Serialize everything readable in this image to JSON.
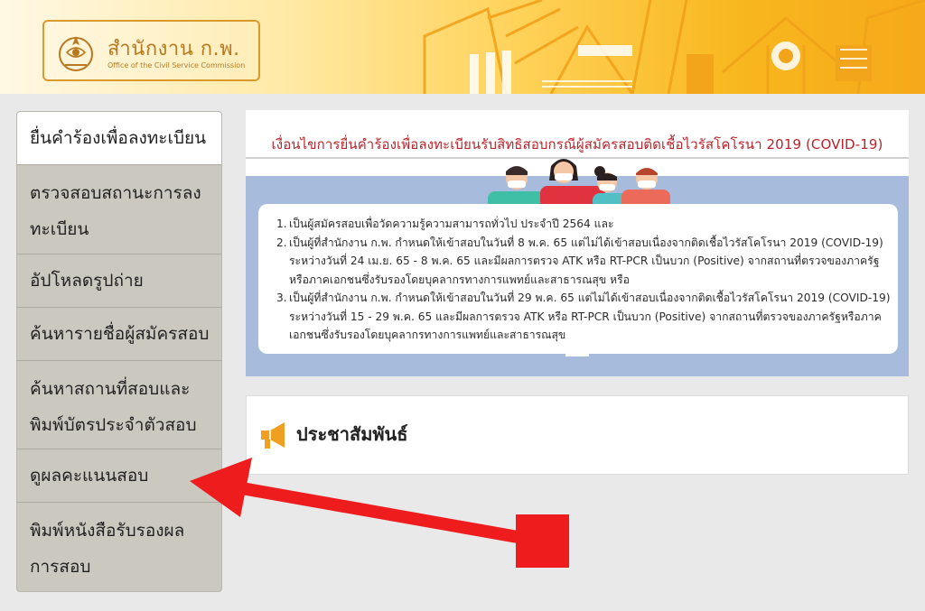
{
  "header": {
    "logo_title": "สำนักงาน ก.พ.",
    "logo_subtitle": "Office of the Civil Service Commission",
    "emblem_icon": "garuda-emblem-icon"
  },
  "sidebar": {
    "items": [
      {
        "label": "ยื่นคำร้องเพื่อลงทะเบียน",
        "active": true
      },
      {
        "label_line1": "ตรวจสอบสถานะการลง",
        "label_line2": "ทะเบียน"
      },
      {
        "label": "อัปโหลดรูปถ่าย"
      },
      {
        "label": "ค้นหารายชื่อผู้สมัครสอบ"
      },
      {
        "label_line1": "ค้นหาสถานที่สอบและ",
        "label_line2": "พิมพ์บัตรประจำตัวสอบ"
      },
      {
        "label": "ดูผลคะแนนสอบ"
      },
      {
        "label_line1": "พิมพ์หนังสือรับรองผล",
        "label_line2": "การสอบ"
      }
    ]
  },
  "announcement": {
    "title": "เงื่อนไขการยื่นคำร้องเพื่อลงทะเบียนรับสิทธิสอบกรณีผู้สมัครสอบติดเชื้อไวรัสโคโรนา 2019 (COVID-19)",
    "items": [
      {
        "num": "1.",
        "text": "เป็นผู้สมัครสอบเพื่อวัดความรู้ความสามารถทั่วไป ประจำปี 2564 และ"
      },
      {
        "num": "2.",
        "text": "เป็นผู้ที่สำนักงาน ก.พ. กำหนดให้เข้าสอบในวันที่ 8 พ.ค. 65 แต่ไม่ได้เข้าสอบเนื่องจากติดเชื้อไวรัสโคโรนา 2019 (COVID-19) ระหว่างวันที่ 24 เม.ย. 65 - 8 พ.ค. 65 และมีผลการตรวจ ATK หรือ RT-PCR เป็นบวก (Positive) จากสถานที่ตรวจของภาครัฐหรือภาคเอกชนซึ่งรับรองโดยบุคลากรทางการแพทย์และสาธารณสุข หรือ"
      },
      {
        "num": "3.",
        "text": "เป็นผู้ที่สำนักงาน ก.พ. กำหนดให้เข้าสอบในวันที่ 29 พ.ค. 65 แต่ไม่ได้เข้าสอบเนื่องจากติดเชื้อไวรัสโคโรนา 2019 (COVID-19) ระหว่างวันที่ 15 - 29 พ.ค. 65 และมีผลการตรวจ ATK หรือ RT-PCR เป็นบวก (Positive) จากสถานที่ตรวจของภาครัฐหรือภาคเอกชนซึ่งรับรองโดยบุคลากรทางการแพทย์และสาธารณสุข"
      }
    ]
  },
  "public_relations": {
    "title": "ประชาสัมพันธ์",
    "icon": "megaphone-icon"
  },
  "annotation": {
    "arrow_color": "#ee1c1c",
    "marker_color": "#ee1c1c"
  }
}
